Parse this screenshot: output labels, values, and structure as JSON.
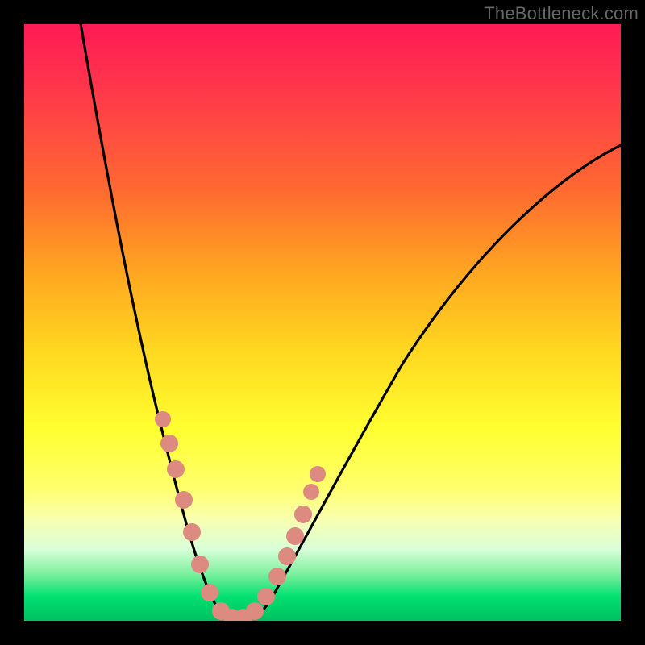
{
  "watermark": {
    "text": "TheBottleneck.com"
  },
  "chart_data": {
    "type": "line",
    "title": "",
    "xlabel": "",
    "ylabel": "",
    "xlim": [
      0,
      100
    ],
    "ylim": [
      0,
      100
    ],
    "series": [
      {
        "name": "bottleneck-curve",
        "x": [
          0,
          4,
          8,
          12,
          16,
          20,
          24,
          26,
          28,
          30,
          32,
          34,
          36,
          38,
          40,
          44,
          48,
          52,
          56,
          60,
          66,
          72,
          80,
          90,
          100
        ],
        "values": [
          110,
          95,
          80,
          65,
          50,
          36,
          22,
          15,
          8,
          3,
          1,
          0,
          0,
          1,
          3,
          8,
          14,
          21,
          28,
          35,
          44,
          53,
          62,
          72,
          80
        ]
      }
    ],
    "markers": {
      "name": "highlight-dots",
      "x": [
        20.5,
        21.5,
        22.5,
        24.0,
        26.0,
        28.0,
        30.5,
        31.5,
        33.0,
        35.0,
        36.5,
        38.0,
        39.5,
        41.0,
        42.0,
        43.5,
        45.0,
        46.0
      ],
      "values": [
        35.0,
        31.0,
        28.0,
        21.0,
        14.0,
        7.0,
        2.0,
        1.2,
        0.5,
        0.3,
        0.5,
        1.0,
        3.0,
        5.5,
        8.0,
        12.0,
        16.0,
        20.0
      ]
    },
    "gradient_stops": [
      {
        "pos": 0.0,
        "color": "#ff1a55"
      },
      {
        "pos": 0.5,
        "color": "#ffd820"
      },
      {
        "pos": 0.8,
        "color": "#ffff70"
      },
      {
        "pos": 1.0,
        "color": "#00c060"
      }
    ],
    "grid": false,
    "legend": false
  }
}
